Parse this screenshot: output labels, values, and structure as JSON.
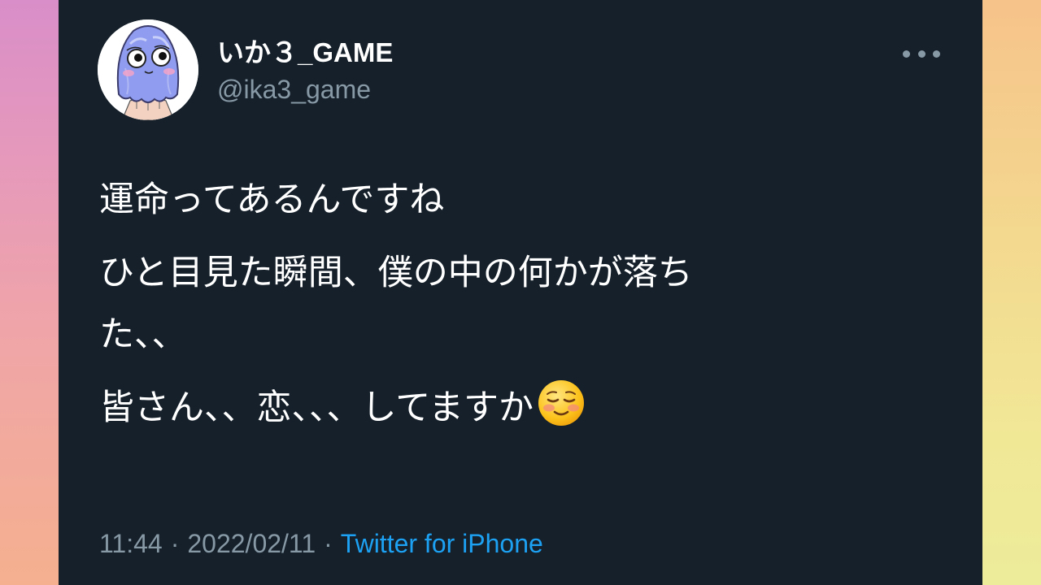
{
  "tweet": {
    "author": {
      "display_name": "いか３_GAME",
      "handle": "@ika3_game",
      "avatar_icon": "squid-character-avatar"
    },
    "menu_icon": "more-horizontal-icon",
    "body": {
      "line1": "運命ってあるんですね",
      "line2a": "ひと目見た瞬間、僕の中の何かが落ち",
      "line2b": "た、、",
      "line3": "皆さん、、恋、、、してますか",
      "emoji": "smiling-face-emoji"
    },
    "meta": {
      "time": "11:44",
      "separator": "·",
      "date": "2022/02/11",
      "source": "Twitter for iPhone"
    }
  },
  "colors": {
    "card_background": "#15202b",
    "primary_text": "#ffffff",
    "secondary_text": "#8899a6",
    "link": "#1da1f2"
  }
}
